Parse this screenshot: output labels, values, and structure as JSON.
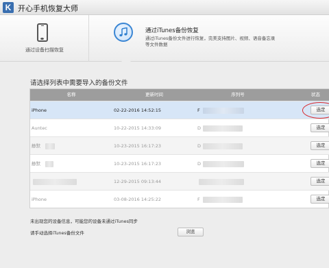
{
  "app": {
    "logo_letter": "K",
    "title": "开心手机恢复大师"
  },
  "modes": {
    "device": {
      "label": "通过设备扫描恢复",
      "icon": "smartphone-icon"
    },
    "itunes": {
      "title": "通过iTunes备份恢复",
      "desc_line1": "通过iTunes备份文件进行恢复，完美支持图片、视频、语音备忘录",
      "desc_line2": "等文件数据",
      "icon": "itunes-music-icon",
      "active": true
    }
  },
  "prompt": "请选择列表中需要导入的备份文件",
  "table": {
    "headers": {
      "name": "名称",
      "time": "更新时间",
      "serial": "序列号",
      "status": "状态"
    },
    "rows": [
      {
        "name": "iPhone",
        "time": "02-22-2016 14:52:15",
        "serial": "F",
        "button": "选定",
        "selected": true
      },
      {
        "name": "Auntec",
        "time": "10-22-2015 14:33:09",
        "serial": "D",
        "button": "选定",
        "selected": false
      },
      {
        "name": "静默",
        "time": "10-23-2015 16:17:23",
        "serial": "D",
        "button": "选定",
        "selected": false
      },
      {
        "name": "静默",
        "time": "10-23-2015 16:17:23",
        "serial": "D",
        "button": "选定",
        "selected": false
      },
      {
        "name": "",
        "time": "12-29-2015 09:13:44",
        "serial": "",
        "button": "选定",
        "selected": false
      },
      {
        "name": "iPhone",
        "time": "03-08-2016 14:25:22",
        "serial": "F",
        "button": "选定",
        "selected": false
      }
    ]
  },
  "footer": {
    "notice": "未出现您的设备信息，可能您的设备未通过iTunes同步",
    "manual": "请手动选择iTunes备份文件",
    "browse": "浏览"
  },
  "colors": {
    "accent": "#3a86d4",
    "highlight_ring": "#d9282b",
    "selected_row": "#d7e6f7",
    "header_bg": "#9d9d9d"
  }
}
